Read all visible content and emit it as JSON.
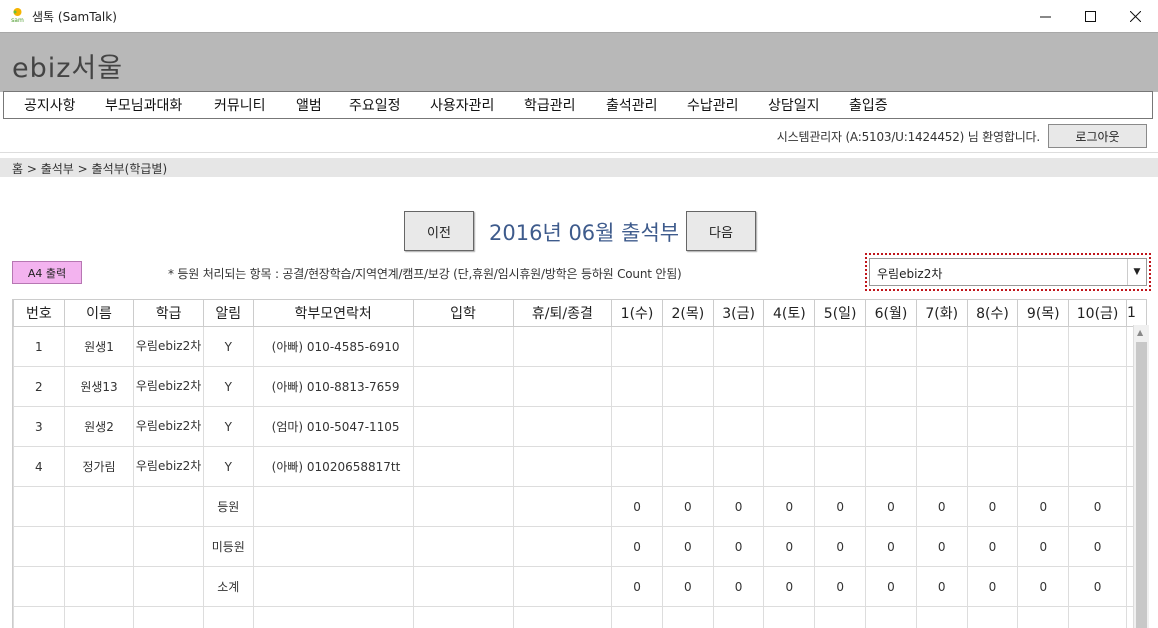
{
  "window": {
    "title": "샘톡 (SamTalk)",
    "icon_text": "sam",
    "minimize": "—",
    "maximize": "☐",
    "close": "✕"
  },
  "banner": {
    "title": "ebiz서울"
  },
  "menu": {
    "items": [
      "공지사항",
      "부모님과대화",
      "커뮤니티",
      "앨범",
      "주요일정",
      "사용자관리",
      "학급관리",
      "출석관리",
      "수납관리",
      "상담일지",
      "출입증"
    ]
  },
  "header": {
    "welcome": "시스템관리자 (A:5103/U:1424452) 님 환영합니다.",
    "logout_label": "로그아웃"
  },
  "breadcrumb": "홈 > 출석부 > 출석부(학급별)",
  "month_nav": {
    "prev_label": "이전",
    "title": "2016년 06월 출석부",
    "next_label": "다음"
  },
  "print_label": "A4 출력",
  "note": "* 등원 처리되는 항목 : 공결/현장학습/지역연계/캠프/보강 (단,휴원/임시휴원/방학은 등하원 Count 안됨)",
  "class_select": {
    "value": "우림ebiz2차",
    "arrow": "▼"
  },
  "table": {
    "headers": [
      "번호",
      "이름",
      "학급",
      "알림",
      "학부모연락처",
      "입학",
      "휴/퇴/종결",
      "1(수)",
      "2(목)",
      "3(금)",
      "4(토)",
      "5(일)",
      "6(월)",
      "7(화)",
      "8(수)",
      "9(목)",
      "10(금)",
      "1"
    ],
    "rows": [
      {
        "cells": [
          "1",
          "원생1",
          "우림ebiz2차",
          "Y",
          "(아빠) 010-4585-6910",
          "",
          "",
          "",
          "",
          "",
          "",
          "",
          "",
          "",
          "",
          "",
          "",
          ""
        ]
      },
      {
        "cells": [
          "2",
          "원생13",
          "우림ebiz2차",
          "Y",
          "(아빠) 010-8813-7659",
          "",
          "",
          "",
          "",
          "",
          "",
          "",
          "",
          "",
          "",
          "",
          "",
          ""
        ]
      },
      {
        "cells": [
          "3",
          "원생2",
          "우림ebiz2차",
          "Y",
          "(엄마) 010-5047-1105",
          "",
          "",
          "",
          "",
          "",
          "",
          "",
          "",
          "",
          "",
          "",
          "",
          ""
        ]
      },
      {
        "cells": [
          "4",
          "정가림",
          "우림ebiz2차",
          "Y",
          "(아빠) 01020658817tt",
          "",
          "",
          "",
          "",
          "",
          "",
          "",
          "",
          "",
          "",
          "",
          "",
          ""
        ]
      }
    ],
    "summary": [
      {
        "cells": [
          "",
          "",
          "",
          "등원",
          "",
          "",
          "",
          "0",
          "0",
          "0",
          "0",
          "0",
          "0",
          "0",
          "0",
          "0",
          "0",
          ""
        ]
      },
      {
        "cells": [
          "",
          "",
          "",
          "미등원",
          "",
          "",
          "",
          "0",
          "0",
          "0",
          "0",
          "0",
          "0",
          "0",
          "0",
          "0",
          "0",
          ""
        ]
      },
      {
        "cells": [
          "",
          "",
          "",
          "소계",
          "",
          "",
          "",
          "0",
          "0",
          "0",
          "0",
          "0",
          "0",
          "0",
          "0",
          "0",
          "0",
          ""
        ]
      },
      {
        "cells": [
          "",
          "",
          "",
          "",
          "",
          "",
          "",
          "",
          "",
          "",
          "",
          "",
          "",
          "",
          "",
          "",
          "",
          ""
        ]
      }
    ]
  },
  "colors": {
    "banner": "#b8b8b8",
    "title_blue": "#3e5b8c",
    "print_pink": "#f3b3ef",
    "highlight_red": "#c0151b"
  }
}
